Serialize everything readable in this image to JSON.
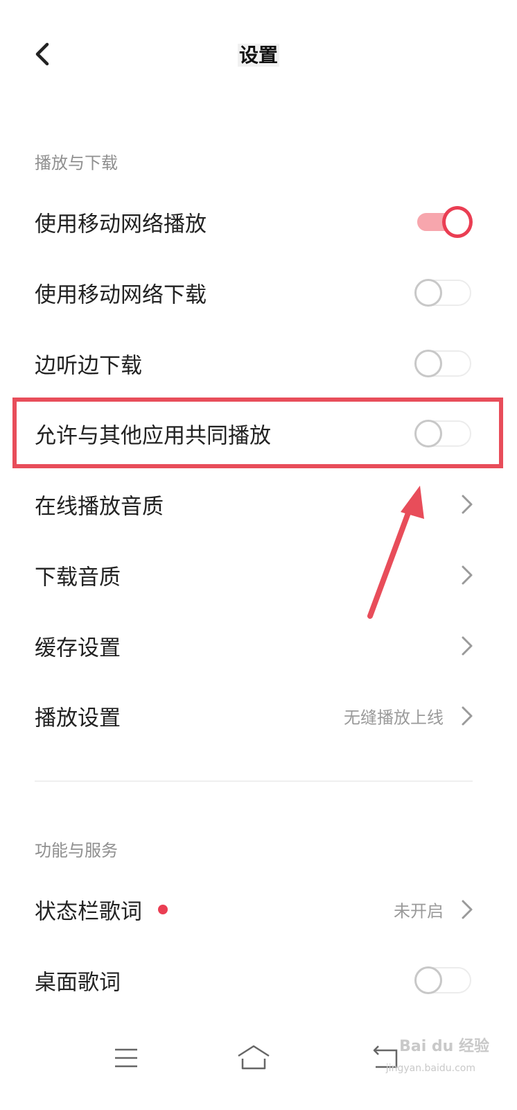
{
  "header": {
    "title": "设置",
    "back_icon": "chevron-left-icon"
  },
  "sections": [
    {
      "title": "播放与下载",
      "items": [
        {
          "label": "使用移动网络播放",
          "control": "toggle",
          "enabled": true
        },
        {
          "label": "使用移动网络下载",
          "control": "toggle",
          "enabled": false
        },
        {
          "label": "边听边下载",
          "control": "toggle",
          "enabled": false
        },
        {
          "label": "允许与其他应用共同播放",
          "control": "toggle",
          "enabled": false,
          "highlighted": true
        },
        {
          "label": "在线播放音质",
          "control": "chevron"
        },
        {
          "label": "下载音质",
          "control": "chevron"
        },
        {
          "label": "缓存设置",
          "control": "chevron"
        },
        {
          "label": "播放设置",
          "control": "chevron",
          "value": "无缝播放上线"
        }
      ]
    },
    {
      "title": "功能与服务",
      "items": [
        {
          "label": "状态栏歌词",
          "control": "chevron",
          "value": "未开启",
          "badge": "red-dot"
        },
        {
          "label": "桌面歌词",
          "control": "toggle",
          "enabled": false
        }
      ]
    }
  ],
  "navbar": {
    "menu_icon": "menu-icon",
    "home_icon": "home-icon",
    "back_icon": "back-icon"
  },
  "annotation": {
    "highlight_color": "#e84d5a",
    "arrow_color": "#e84d5a"
  },
  "watermark": {
    "text": "Bai du 经验",
    "sub": "jingyan.baidu.com"
  },
  "colors": {
    "accent": "#ea3e53",
    "toggle_on_track": "#f7a6ad",
    "section_title": "#8f8f8f",
    "secondary_text": "#9a9a9a"
  }
}
